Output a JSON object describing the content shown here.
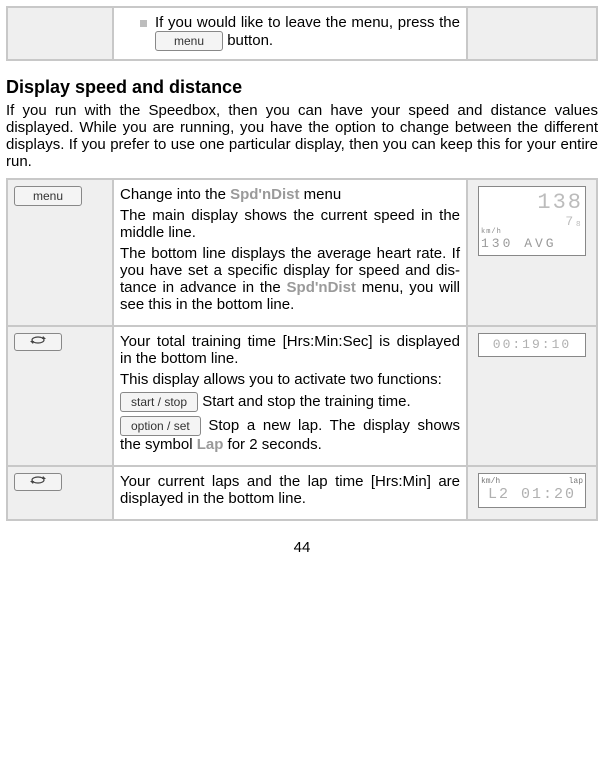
{
  "topRow": {
    "bullet_text_pre": "If you would like to leave the menu, press the ",
    "menu_btn": "menu",
    "bullet_text_post": " button."
  },
  "section_heading": "Display speed and distance",
  "section_para": "If you run with the Speedbox, then you can have your speed and distance values displayed. While you are running, you have the option to change between the different displays. If you prefer to use one particular display, then you can keep this for your entire run.",
  "row1": {
    "btn": "menu",
    "p1_pre": "Change into the ",
    "p1_emph": "Spd'nDist",
    "p1_post": " menu",
    "p2": "The main display shows the current speed in the middle line.",
    "p3_pre": "The bottom line displays the aver­age heart rate. If you have set a specific display for speed and dis­tance in advance in the ",
    "p3_emph": "Spd'nDist",
    "p3_post": " menu, you will see this in the bottom line.",
    "disp_big": "138",
    "disp_sub": "7₈",
    "disp_unit": "km/h",
    "disp_bottom": "130 AVG"
  },
  "row2": {
    "btn": "↻",
    "p1": "Your total training time [Hrs:Min:Sec] is displayed in the bottom line.",
    "p2": "This display allows you to activate two functions:",
    "btn_ss": "start / stop",
    "p3": " Start and stop the training time.",
    "btn_os": "option / set",
    "p4_pre": " Stop a new lap. The dis­play shows the symbol ",
    "p4_emph": "Lap",
    "p4_post": " for 2 seconds.",
    "disp_time": "00:19:10"
  },
  "row3": {
    "btn": "↻",
    "p1": "Your current laps and the lap time [Hrs:Min] are displayed in the bottom line.",
    "disp_top_l": "km/h",
    "disp_top_r": "lap",
    "disp_main": "L2 01:20"
  },
  "page_number": "44"
}
